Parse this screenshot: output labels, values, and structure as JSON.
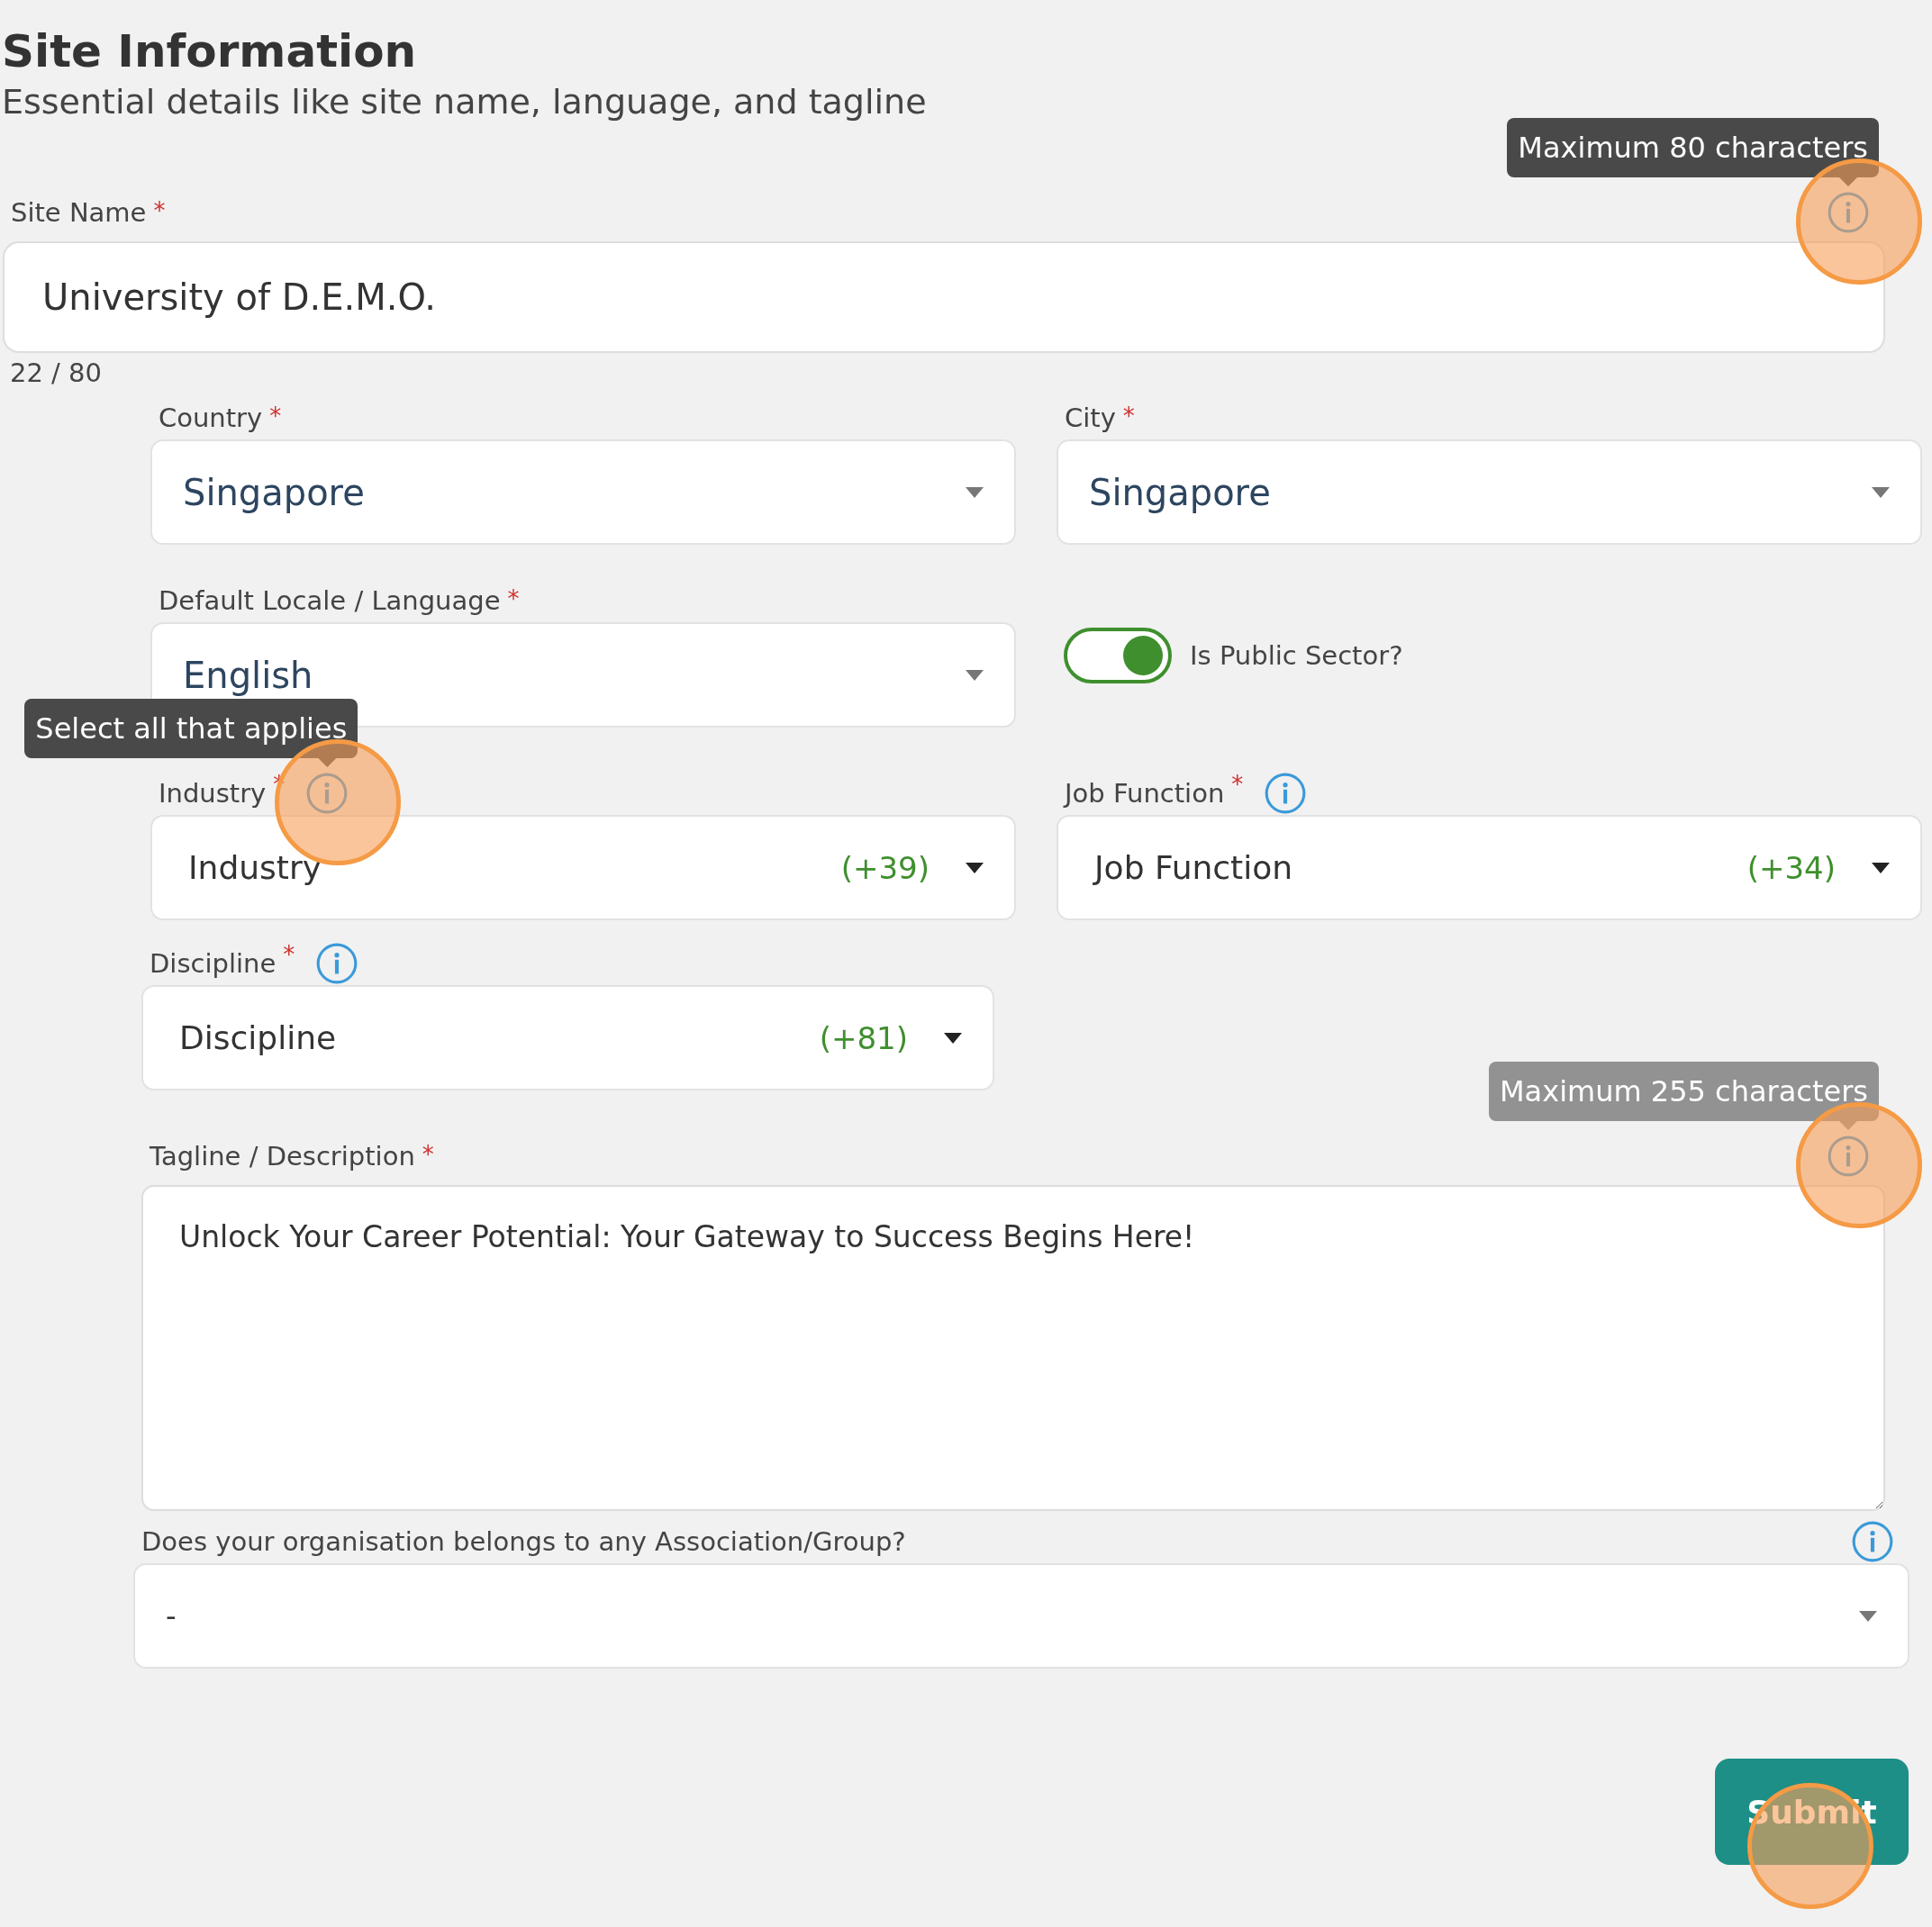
{
  "header": {
    "title": "Site Information",
    "subtitle": "Essential details like site name, language, and tagline"
  },
  "site_name": {
    "label": "Site Name",
    "required_mark": "*",
    "value": "University of D.E.M.O.",
    "counter": "22 / 80",
    "info": {
      "tooltip": "Maximum 80 characters",
      "tooltip_faded": false,
      "highlighted": true
    }
  },
  "rows": [
    {
      "kind": "pair",
      "fields": [
        {
          "kind": "select",
          "label": "Country",
          "required_mark": "*",
          "value": "Singapore"
        },
        {
          "kind": "select",
          "label": "City",
          "required_mark": "*",
          "value": "Singapore"
        }
      ]
    },
    {
      "kind": "pair",
      "fields": [
        {
          "kind": "select",
          "label": "Default Locale / Language",
          "required_mark": "*",
          "value": "English"
        },
        {
          "kind": "toggle",
          "label": "Is Public Sector?",
          "on": true
        }
      ]
    },
    {
      "kind": "pair",
      "fields": [
        {
          "kind": "multiselect",
          "label": "Industry",
          "required_mark": "*",
          "value": "Industry",
          "count": "(+39)",
          "info": {
            "tooltip": "Select all that applies",
            "tooltip_faded": false,
            "highlighted": true
          }
        },
        {
          "kind": "multiselect",
          "label": "Job Function",
          "required_mark": "*",
          "value": "Job Function",
          "count": "(+34)",
          "info": {
            "highlighted": false
          }
        }
      ]
    },
    {
      "kind": "half",
      "fields": [
        {
          "kind": "multiselect",
          "label": "Discipline",
          "required_mark": "*",
          "value": "Discipline",
          "count": "(+81)",
          "info": {
            "highlighted": false
          }
        }
      ]
    },
    {
      "kind": "full",
      "fields": [
        {
          "kind": "textarea",
          "label": "Tagline / Description",
          "required_mark": "*",
          "value": "Unlock Your Career Potential: Your Gateway to Success Begins Here!",
          "info": {
            "tooltip": "Maximum 255 characters",
            "tooltip_faded": true,
            "highlighted": true
          }
        }
      ]
    },
    {
      "kind": "wide",
      "fields": [
        {
          "kind": "select",
          "label": "Does your organisation belongs to any Association/Group?",
          "value": "-",
          "info": {
            "highlighted": false
          }
        }
      ]
    }
  ],
  "submit": {
    "label": "Submit",
    "highlighted": true
  }
}
